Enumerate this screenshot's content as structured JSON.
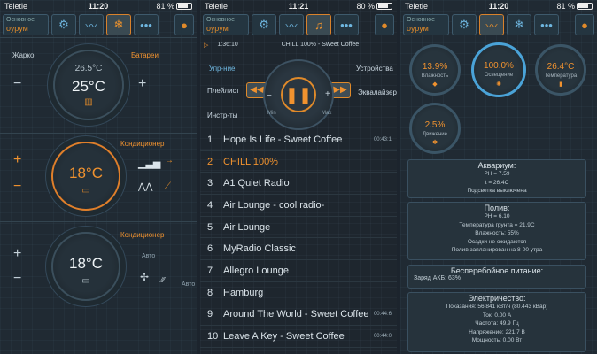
{
  "status": [
    {
      "carrier": "Teletie",
      "time": "11:20",
      "battery": "81 %",
      "level": 0.81
    },
    {
      "carrier": "Teletie",
      "time": "11:21",
      "battery": "80 %",
      "level": 0.8
    },
    {
      "carrier": "Teletie",
      "time": "11:20",
      "battery": "81 %",
      "level": 0.81
    }
  ],
  "tabs": {
    "main_line1": "Основное",
    "main_line2": "оурум"
  },
  "climate": {
    "hot_label": "Жарко",
    "battery_label": "Батареи",
    "indoor_temp": "26.5°C",
    "set_temp": "25°C",
    "ac_label": "Кондиционер",
    "ac_temp": "18°C",
    "ac2_label": "Кондиционер",
    "ac2_temp": "18°C",
    "auto": "Авто",
    "auto2": "Авто",
    "minus": "−",
    "plus": "+"
  },
  "player": {
    "elapsed": "1:36:10",
    "now_playing": "CHILL 100% - Sweet Coffee",
    "control": "Упр-ние",
    "devices": "Устройства",
    "playlist": "Плейлист",
    "equalizer": "Эквалайзер",
    "tools": "Инстр-ты",
    "min": "Min",
    "max": "Max",
    "tracks": [
      {
        "n": "1",
        "title": "Hope Is Life - Sweet Coffee",
        "dur": "00:43:1"
      },
      {
        "n": "2",
        "title": "CHILL 100%",
        "dur": ""
      },
      {
        "n": "3",
        "title": "A1 Quiet Radio",
        "dur": ""
      },
      {
        "n": "4",
        "title": "Air Lounge - cool radio-",
        "dur": ""
      },
      {
        "n": "5",
        "title": "Air Lounge",
        "dur": ""
      },
      {
        "n": "6",
        "title": "MyRadio Classic",
        "dur": ""
      },
      {
        "n": "7",
        "title": "Allegro Lounge",
        "dur": ""
      },
      {
        "n": "8",
        "title": "Hamburg",
        "dur": ""
      },
      {
        "n": "9",
        "title": "Around The World - Sweet Coffee",
        "dur": "00:44:6"
      },
      {
        "n": "10",
        "title": "Leave A Key - Sweet Coffee",
        "dur": "00:44:0"
      }
    ]
  },
  "sensors": {
    "gauges": [
      {
        "value": "13.9%",
        "caption": "Влажность"
      },
      {
        "value": "100.0%",
        "caption": "Освещение"
      },
      {
        "value": "26.4°C",
        "caption": "Температура"
      },
      {
        "value": "2.5%",
        "caption": "Движение"
      }
    ],
    "aquarium": {
      "title": "Аквариум:",
      "lines": [
        "PH = 7.59",
        "t = 26.4C",
        "Подсветка выключена"
      ]
    },
    "watering": {
      "title": "Полив:",
      "lines": [
        "PH = 6.10",
        "Температура грунта = 21.9С",
        "Влажность: 55%",
        "Осадки не ожидаются",
        "Полив запланирован на 8-00 утра"
      ]
    },
    "ups": {
      "title": "Бесперебойное питание:",
      "line": "Заряд АКБ: 63%"
    },
    "power": {
      "title": "Электричество:",
      "lines": [
        "Показания: 56.841 кВт/ч (80.443 кВар)",
        "Ток: 0.00 А",
        "Частота: 49.9 Гц",
        "Напряжение: 221.7 В",
        "Мощность: 0.00 Вт"
      ]
    }
  }
}
